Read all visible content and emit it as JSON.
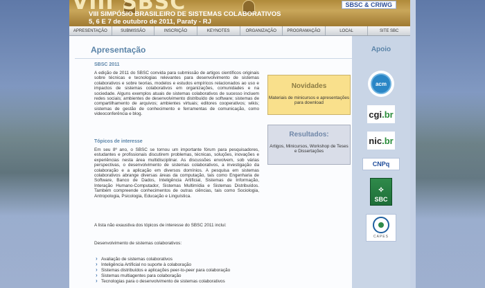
{
  "header": {
    "big_title": "VIII SBSC",
    "line1": "VIII SIMPÓSIO BRASILEIRO DE SISTEMAS COLABORATIVOS",
    "line2": "5, 6 E 7 de outubro de 2011, Paraty - RJ",
    "brand": "SBSC & CRIWG"
  },
  "nav": {
    "items": [
      "APRESENTAÇÃO",
      "SUBMISSÃO",
      "INSCRIÇÃO",
      "KEYNOTES",
      "ORGANIZAÇÃO",
      "PROGRAMAÇÃO",
      "LOCAL",
      "SITE SBC"
    ]
  },
  "main": {
    "title": "Apresentação",
    "section1_heading": "SBSC 2011",
    "section1_text": "A edição de 2011 do SBSC convida para submissão de artigos científicos originais sobre técnicas e tecnologias relevantes para desenvolvimento de sistemas colaborativos e sobre teorias, modelos e estudos empíricos relacionados ao uso e impactos de sistemas colaborativos em organizações, comunidades e na sociedade. Alguns exemplos atuais de sistemas colaborativos de sucesso incluem redes sociais; ambientes de desenvolvimento distribuído de software; sistemas de compartilhamento de arquivos; ambientes virtuais; editores cooperativos; wikis; sistemas de gestão de conhecimento e ferramentas de comunicação, como videoconferência e blog.",
    "section2_heading": "Tópicos de interesse",
    "section2_text": "Em seu 8º ano, o SBSC se tornou um importante fórum para pesquisadores, estudantes e profissionais discutirem problemas, técnicas, soluções, inovações e experiências nesta área multidisciplinar. As discussões envolvem, sob várias perspectivas, o desenvolvimento de sistemas colaborativos, a investigação da colaboração e a aplicação em diversos domínios. A pesquisa em sistemas colaborativos abrange diversas áreas da computação, tais como Engenharia de Software, Banco de Dados, Inteligência Artificial, Sistemas de Informação, Interação Humano-Computador, Sistemas Multimídia e Sistemas Distribuídos. Também compreende conhecimentos de outras ciências, tais como Sociologia, Antropologia, Psicologia, Educação e Linguística.",
    "list_intro": "A lista não exaustiva dos tópicos de interesse do SBSC 2011 inclui:",
    "subheading": "Desenvolvimento de sistemas colaborativos:",
    "bullets": [
      "Avaliação de sistemas colaborativos",
      "Inteligência Artificial no suporte à colaboração",
      "Sistemas distribuídos e aplicações peer-to-peer para colaboração",
      "Sistemas multiagentes para colaboração",
      "Tecnologias para o desenvolvimento de sistemas colaborativos"
    ]
  },
  "novidades": {
    "title": "Novidades",
    "text": "Materiais de minicursos e apresentações para download"
  },
  "resultados": {
    "title": "Resultados:",
    "text": "Artigos, Minicursos, Workshop de Teses e Dissertações"
  },
  "sidebar": {
    "title": "Apoio",
    "logos": {
      "acm": "acm",
      "cgi_a": "cgi",
      "cgi_b": ".br",
      "nic_a": "nic",
      "nic_b": ".br",
      "cnpq": "CNPq",
      "sbc": "SBC",
      "capes": "CAPES"
    }
  }
}
